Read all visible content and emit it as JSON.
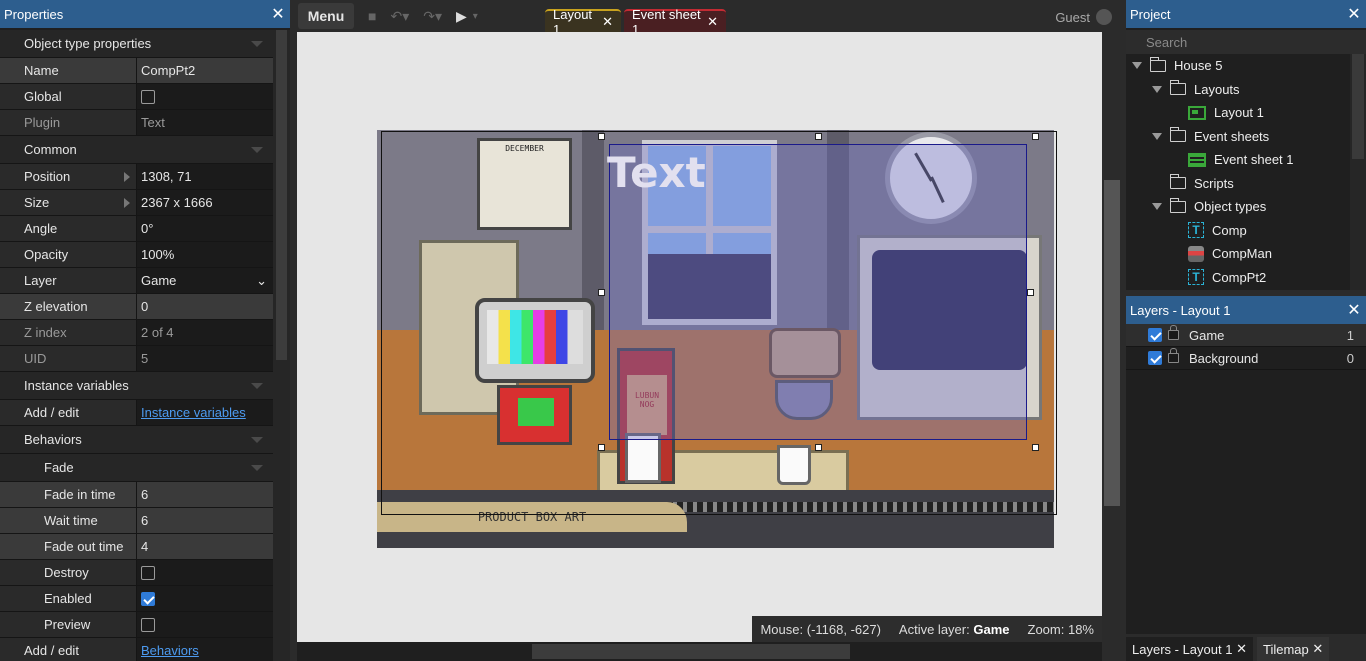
{
  "properties": {
    "title": "Properties",
    "sections": {
      "object_type": "Object type properties",
      "common": "Common",
      "instance_vars": "Instance variables",
      "behaviors": "Behaviors",
      "fade": "Fade"
    },
    "rows": {
      "name": {
        "label": "Name",
        "value": "CompPt2"
      },
      "global": {
        "label": "Global"
      },
      "plugin": {
        "label": "Plugin",
        "value": "Text"
      },
      "position": {
        "label": "Position",
        "value": "1308, 71"
      },
      "size": {
        "label": "Size",
        "value": "2367 x 1666"
      },
      "angle": {
        "label": "Angle",
        "value": "0°"
      },
      "opacity": {
        "label": "Opacity",
        "value": "100%"
      },
      "layer": {
        "label": "Layer",
        "value": "Game"
      },
      "z_elevation": {
        "label": "Z elevation",
        "value": "0"
      },
      "z_index": {
        "label": "Z index",
        "value": "2 of 4"
      },
      "uid": {
        "label": "UID",
        "value": "5"
      },
      "inst_add": {
        "label": "Add / edit",
        "value": "Instance variables"
      },
      "fade_in": {
        "label": "Fade in time",
        "value": "6"
      },
      "wait": {
        "label": "Wait time",
        "value": "6"
      },
      "fade_out": {
        "label": "Fade out time",
        "value": "4"
      },
      "destroy": {
        "label": "Destroy"
      },
      "enabled": {
        "label": "Enabled"
      },
      "preview": {
        "label": "Preview"
      },
      "beh_add": {
        "label": "Add / edit",
        "value": "Behaviors"
      }
    }
  },
  "toolbar": {
    "menu": "Menu",
    "tabs": [
      {
        "label": "Layout 1"
      },
      {
        "label": "Event sheet 1"
      }
    ],
    "user": "Guest"
  },
  "scene": {
    "text_object": "Text",
    "calendar_month": "DECEMBER",
    "carton_label": "LUBUN NOG",
    "strip_label": "PRODUCT BOX ART"
  },
  "status": {
    "mouse_label": "Mouse:",
    "mouse_value": "(-1168, -627)",
    "layer_label": "Active layer:",
    "layer_value": "Game",
    "zoom_label": "Zoom:",
    "zoom_value": "18%"
  },
  "project": {
    "title": "Project",
    "search_placeholder": "Search",
    "tree": {
      "root": "House 5",
      "layouts": "Layouts",
      "layout1": "Layout 1",
      "event_sheets": "Event sheets",
      "event_sheet1": "Event sheet 1",
      "scripts": "Scripts",
      "object_types": "Object types",
      "obj1": "Comp",
      "obj2": "CompMan",
      "obj3": "CompPt2"
    }
  },
  "layers": {
    "title": "Layers - Layout 1",
    "items": [
      {
        "name": "Game",
        "index": "1"
      },
      {
        "name": "Background",
        "index": "0"
      }
    ]
  },
  "bottom_tabs": [
    "Layers - Layout 1",
    "Tilemap"
  ]
}
